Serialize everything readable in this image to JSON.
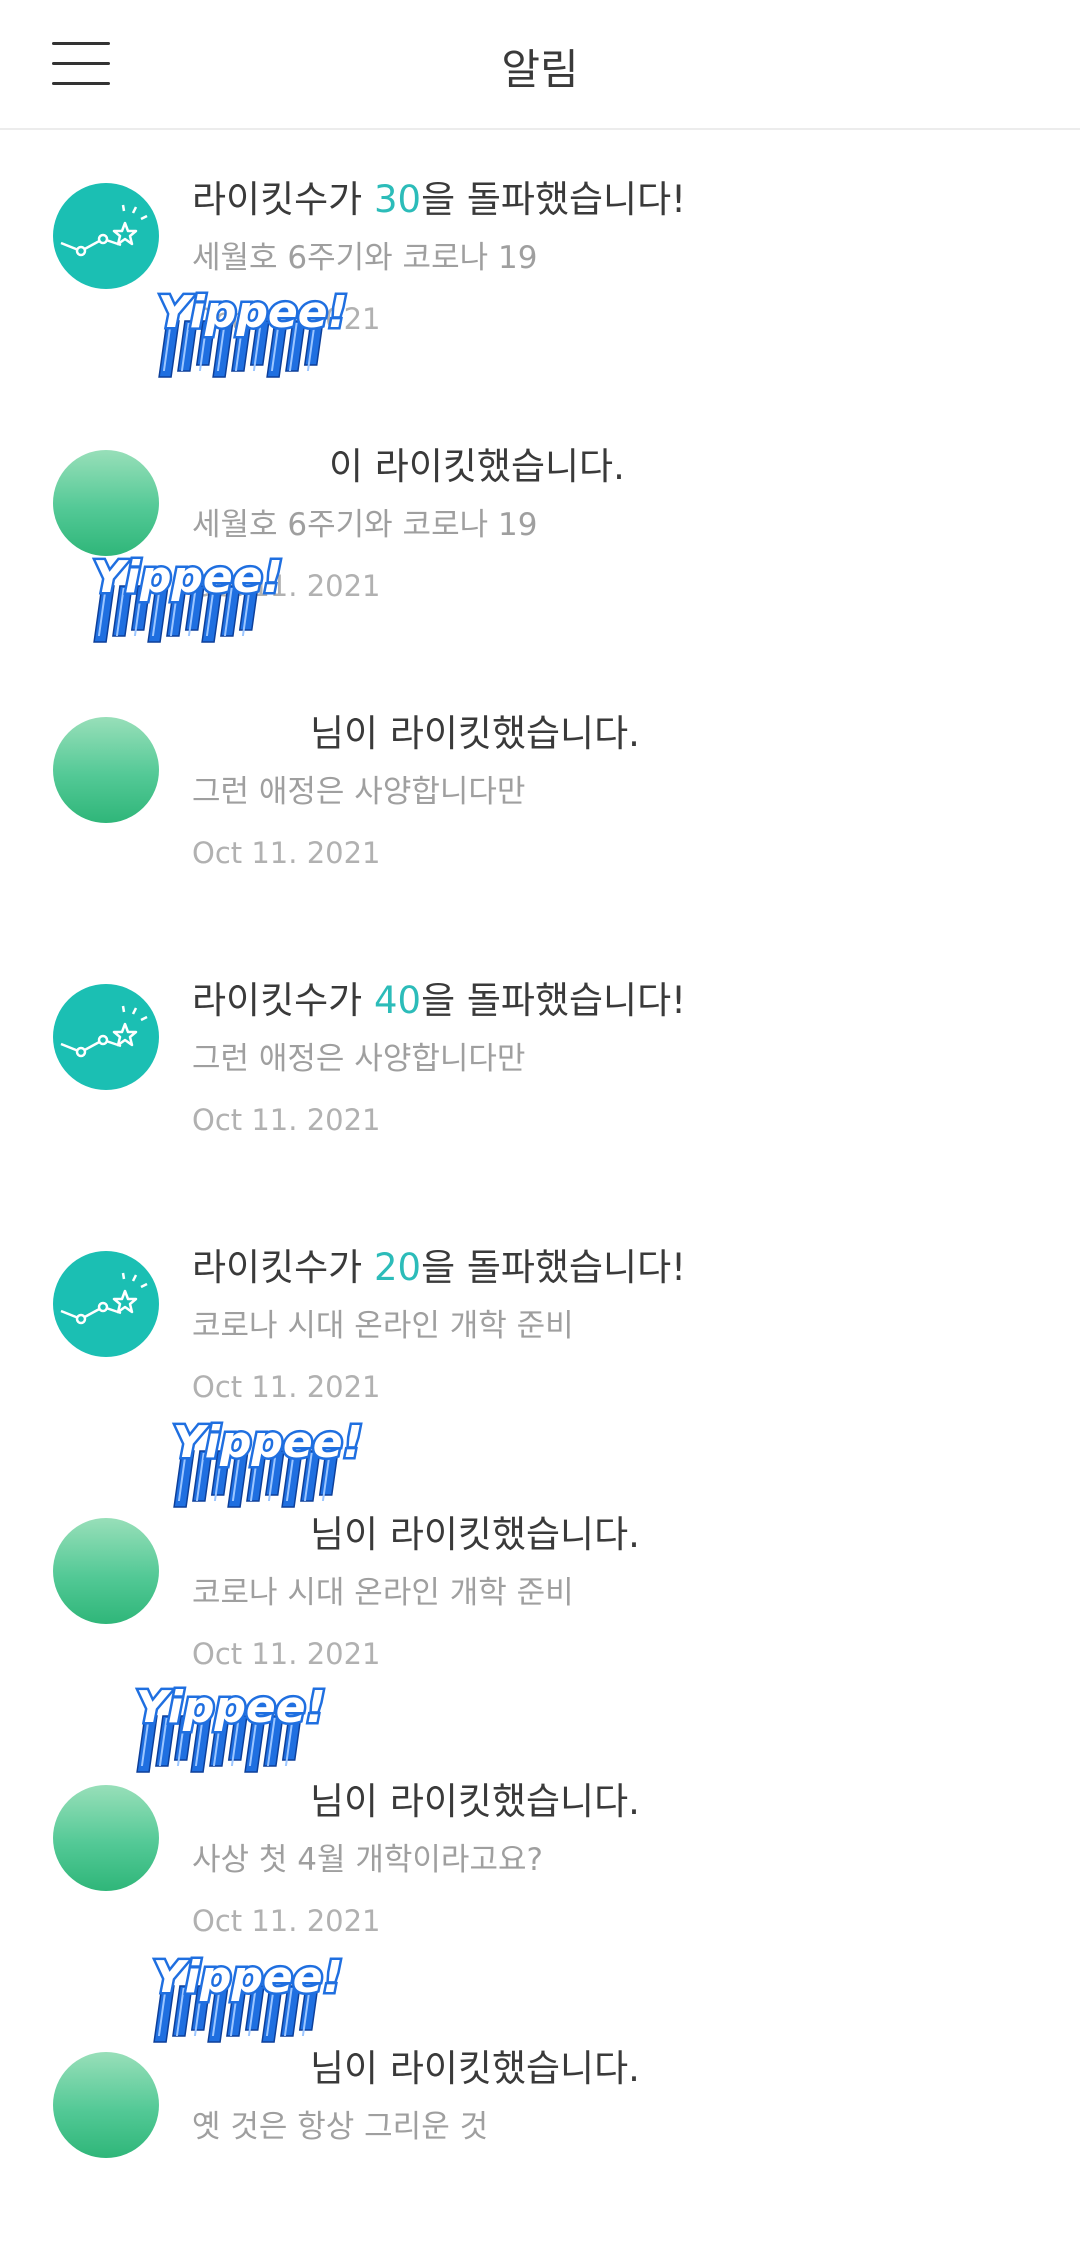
{
  "header": {
    "title": "알림",
    "menu_icon": "hamburger-menu-icon"
  },
  "colors": {
    "milestone_avatar": "#1bbfb3",
    "highlight_number": "#2cbcb9",
    "user_avatar_top": "#98dfb9",
    "user_avatar_bottom": "#2fb679",
    "sticker_blue": "#1f6fe0"
  },
  "sticker": {
    "text": "Yippee!",
    "icon": "yippee-sticker"
  },
  "notifications": [
    {
      "type": "milestone",
      "icon": "trend-star-icon",
      "message_prefix": "라이킷수가 ",
      "message_number": "30",
      "message_suffix": "을 돌파했습니다!",
      "subtitle": "세월호 6주기와 코로나 19",
      "date": "Oct 11. 2021"
    },
    {
      "type": "like",
      "message_text": "이 라이킷했습니다.",
      "subtitle": "세월호 6주기와 코로나 19",
      "date": "Oct 11. 2021"
    },
    {
      "type": "like",
      "message_text": "님이 라이킷했습니다.",
      "subtitle": "그런 애정은 사양합니다만",
      "date": "Oct 11. 2021"
    },
    {
      "type": "milestone",
      "icon": "trend-star-icon",
      "message_prefix": "라이킷수가 ",
      "message_number": "40",
      "message_suffix": "을 돌파했습니다!",
      "subtitle": "그런 애정은 사양합니다만",
      "date": "Oct 11. 2021"
    },
    {
      "type": "milestone",
      "icon": "trend-star-icon",
      "message_prefix": "라이킷수가 ",
      "message_number": "20",
      "message_suffix": "을 돌파했습니다!",
      "subtitle": "코로나 시대 온라인 개학 준비",
      "date": "Oct 11. 2021"
    },
    {
      "type": "like",
      "message_text": "님이 라이킷했습니다.",
      "subtitle": "코로나 시대 온라인 개학 준비",
      "date": "Oct 11. 2021"
    },
    {
      "type": "like",
      "message_text": "님이 라이킷했습니다.",
      "subtitle": "사상 첫 4월 개학이라고요?",
      "date": "Oct 11. 2021"
    },
    {
      "type": "like",
      "message_text": "님이 라이킷했습니다.",
      "subtitle": "옛 것은 항상 그리운 것",
      "date": ""
    }
  ]
}
